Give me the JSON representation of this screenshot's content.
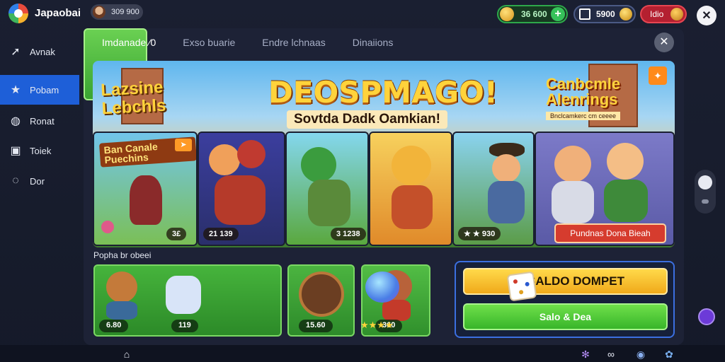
{
  "header": {
    "app_title": "Japaobai",
    "coins_small": "309 900",
    "green_currency": "36 600",
    "mid_currency": "5900",
    "red_currency": "Idio"
  },
  "sidebar": {
    "items": [
      {
        "label": "Avnak",
        "icon": "arrow-icon"
      },
      {
        "label": "Pobam",
        "icon": "star-icon",
        "active": true
      },
      {
        "label": "Ronat",
        "icon": "globe-icon"
      },
      {
        "label": "Toiek",
        "icon": "box-icon"
      },
      {
        "label": "Dor",
        "icon": "chat-icon"
      }
    ]
  },
  "tabs": [
    {
      "label": "Imdanade ⁄0",
      "active": true
    },
    {
      "label": "Exso buarie"
    },
    {
      "label": "Endre lchnaas"
    },
    {
      "label": "Dinaiions"
    }
  ],
  "banner": {
    "title": "DEOSPMAGO!",
    "subtitle": "Sovtda Dadk Oamkian!",
    "logo_left": "Lazsine Lebchls",
    "logo_right": "Canbcmle Alenrings",
    "logo_right_sub": "Bnclcamkerc cm ceeee"
  },
  "cards": [
    {
      "title": "Ban Canale Puechins",
      "price": "3£"
    },
    {
      "price": "21 139"
    },
    {
      "price": "3 1238"
    },
    {
      "price": ""
    },
    {
      "price": "★ ★ 930"
    },
    {
      "button": "Pundnas Dona Bieah"
    }
  ],
  "section_label": "Popha br obeei",
  "offers": [
    {
      "price": "6.80"
    },
    {
      "price": "119"
    },
    {
      "price": "15.60"
    },
    {
      "price": "360"
    }
  ],
  "stars_text": "★★★★",
  "cta": {
    "primary": "SALDO DOMPET",
    "secondary": "Salo & Dea"
  },
  "colors": {
    "accent_blue": "#1e5fd8",
    "gold": "#ffd33b",
    "green": "#38b52a",
    "red": "#b42030"
  }
}
